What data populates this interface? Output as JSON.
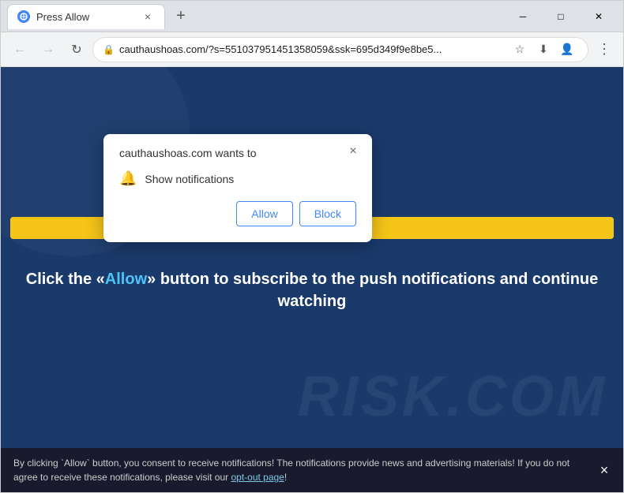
{
  "browser": {
    "tab_title": "Press Allow",
    "tab_close_label": "×",
    "new_tab_label": "+",
    "window_controls": {
      "minimize": "─",
      "maximize": "□",
      "close": "✕"
    },
    "address": "cauthaushoas.com/?s=551037951451358059&ssk=695d349f9e8be5...",
    "address_icon": "🔒"
  },
  "notification_dialog": {
    "title": "cauthaushoas.com wants to",
    "permission_label": "Show notifications",
    "allow_label": "Allow",
    "block_label": "Block",
    "close_label": "×"
  },
  "page": {
    "progress_value": "98%",
    "cta_text_before": "Click the «",
    "cta_allow": "Allow",
    "cta_text_after": "» button to subscribe to the push notifications and continue watching",
    "watermark": "RISK.COM"
  },
  "consent_bar": {
    "text_before": "By clicking `Allow` button, you consent to receive notifications! The notifications provide news and advertising materials! If you do not agree to receive these notifications, please visit our ",
    "link_text": "opt-out page",
    "text_after": "!",
    "close_label": "×"
  }
}
